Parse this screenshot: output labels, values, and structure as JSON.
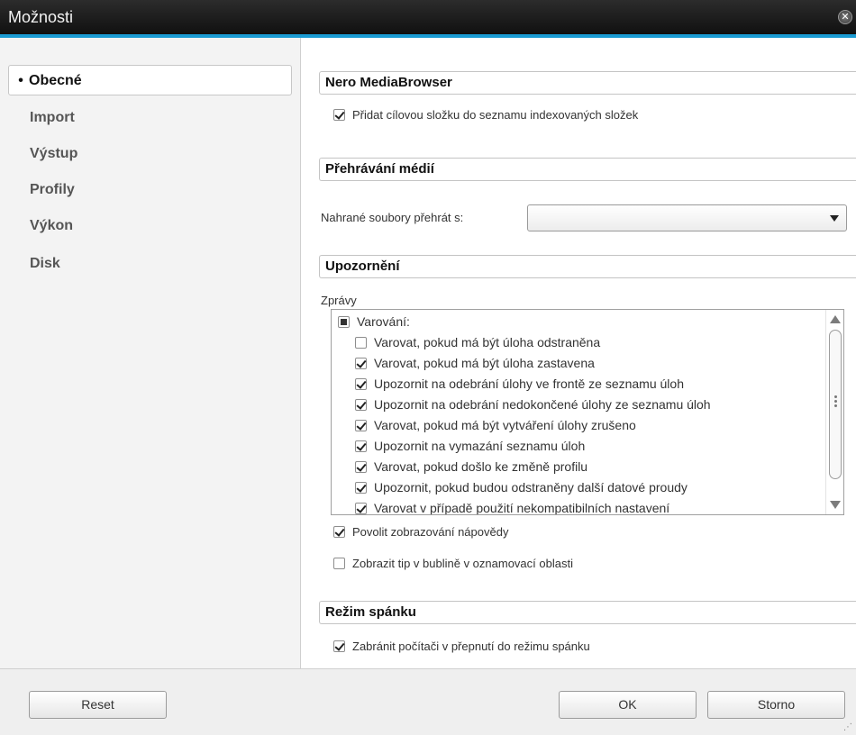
{
  "window": {
    "title": "Možnosti",
    "close_glyph": "✕"
  },
  "sidebar": {
    "items": [
      {
        "label": "Obecné",
        "active": true
      },
      {
        "label": "Import",
        "active": false
      },
      {
        "label": "Výstup",
        "active": false
      },
      {
        "label": "Profily",
        "active": false
      },
      {
        "label": "Výkon",
        "active": false
      },
      {
        "label": "Disk",
        "active": false
      }
    ]
  },
  "sections": {
    "media_browser": {
      "title": "Nero MediaBrowser",
      "add_folder_label": "Přidat cílovou složku do seznamu indexovaných složek",
      "add_folder_checked": true
    },
    "media_playback": {
      "title": "Přehrávání médií",
      "play_with_label": "Nahrané soubory přehrát s:",
      "play_with_value": ""
    },
    "notifications": {
      "title": "Upozornění",
      "messages_label": "Zprávy",
      "group_label": "Varování:",
      "items": [
        {
          "label": "Varovat, pokud má být úloha odstraněna",
          "checked": false
        },
        {
          "label": "Varovat, pokud má být úloha zastavena",
          "checked": true
        },
        {
          "label": "Upozornit na odebrání úlohy ve frontě ze seznamu úloh",
          "checked": true
        },
        {
          "label": "Upozornit na odebrání nedokončené úlohy ze seznamu úloh",
          "checked": true
        },
        {
          "label": "Varovat, pokud má být vytváření úlohy zrušeno",
          "checked": true
        },
        {
          "label": "Upozornit na vymazání seznamu úloh",
          "checked": true
        },
        {
          "label": "Varovat, pokud došlo ke změně profilu",
          "checked": true
        },
        {
          "label": "Upozornit, pokud budou odstraněny další datové proudy",
          "checked": true
        },
        {
          "label": "Varovat v případě použití nekompatibilních nastavení",
          "checked": true
        }
      ],
      "enable_help_label": "Povolit zobrazování nápovědy",
      "enable_help_checked": true,
      "tray_tip_label": "Zobrazit tip v bublině v oznamovací oblasti",
      "tray_tip_checked": false
    },
    "sleep_mode": {
      "title": "Režim spánku",
      "prevent_sleep_label": "Zabránit počítači v přepnutí do režimu spánku",
      "prevent_sleep_checked": true
    }
  },
  "footer": {
    "reset_label": "Reset",
    "ok_label": "OK",
    "cancel_label": "Storno"
  }
}
